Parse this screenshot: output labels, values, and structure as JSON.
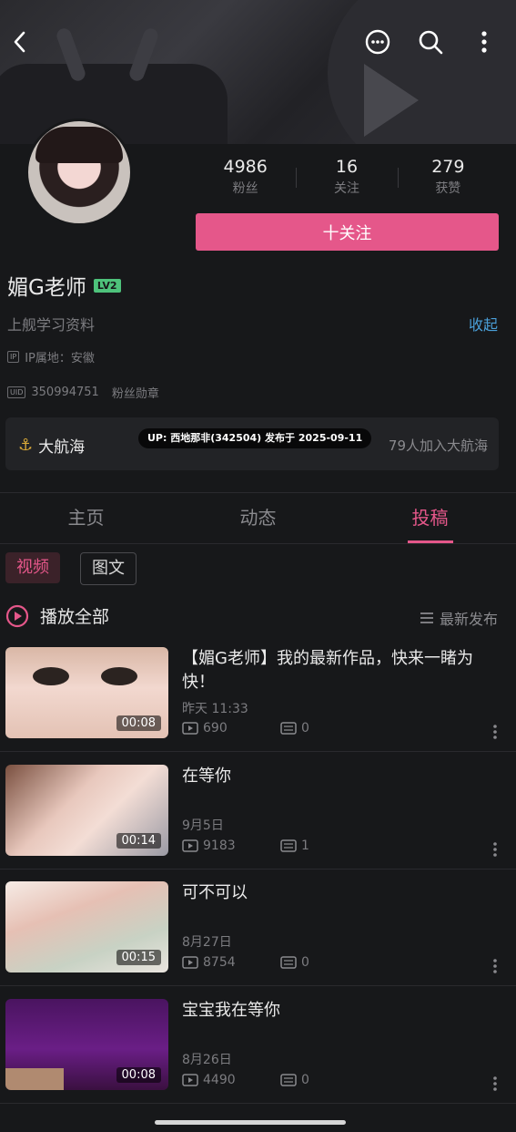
{
  "header": {
    "back_icon": "chevron-left-icon",
    "message_icon": "chat-bubble-icon",
    "search_icon": "search-icon",
    "more_icon": "more-vertical-icon"
  },
  "profile": {
    "name": "媚G老师",
    "level": "LV2",
    "signature": "上舰学习资料",
    "collapse_label": "收起",
    "ip_tag": "IP",
    "ip_location": "IP属地：安徽",
    "uid_tag": "UID",
    "uid": "350994751",
    "fan_medal": "粉丝勋章",
    "follow_button": "十关注"
  },
  "stats": [
    {
      "value": "4986",
      "label": "粉丝"
    },
    {
      "value": "16",
      "label": "关注"
    },
    {
      "value": "279",
      "label": "获赞"
    }
  ],
  "fleet": {
    "title": "大航海",
    "joined": "79人加入大航海"
  },
  "watermark": "UP: 西地那非(342504) 发布于 2025-09-11",
  "tabs": [
    "主页",
    "动态",
    "投稿"
  ],
  "active_tab": "投稿",
  "filters": [
    "视频",
    "图文"
  ],
  "play_all": "播放全部",
  "sort": "最新发布",
  "videos": [
    {
      "title": "【媚G老师】我的最新作品，快来一睹为快！",
      "date": "昨天 11:33",
      "views": "690",
      "comments": "0",
      "duration": "00:08"
    },
    {
      "title": "在等你",
      "date": "9月5日",
      "views": "9183",
      "comments": "1",
      "duration": "00:14"
    },
    {
      "title": "可不可以",
      "date": "8月27日",
      "views": "8754",
      "comments": "0",
      "duration": "00:15"
    },
    {
      "title": "宝宝我在等你",
      "date": "8月26日",
      "views": "4490",
      "comments": "0",
      "duration": "00:08"
    }
  ],
  "colors": {
    "accent": "#e5578a",
    "link": "#4a9fd8",
    "background": "#17181a"
  }
}
